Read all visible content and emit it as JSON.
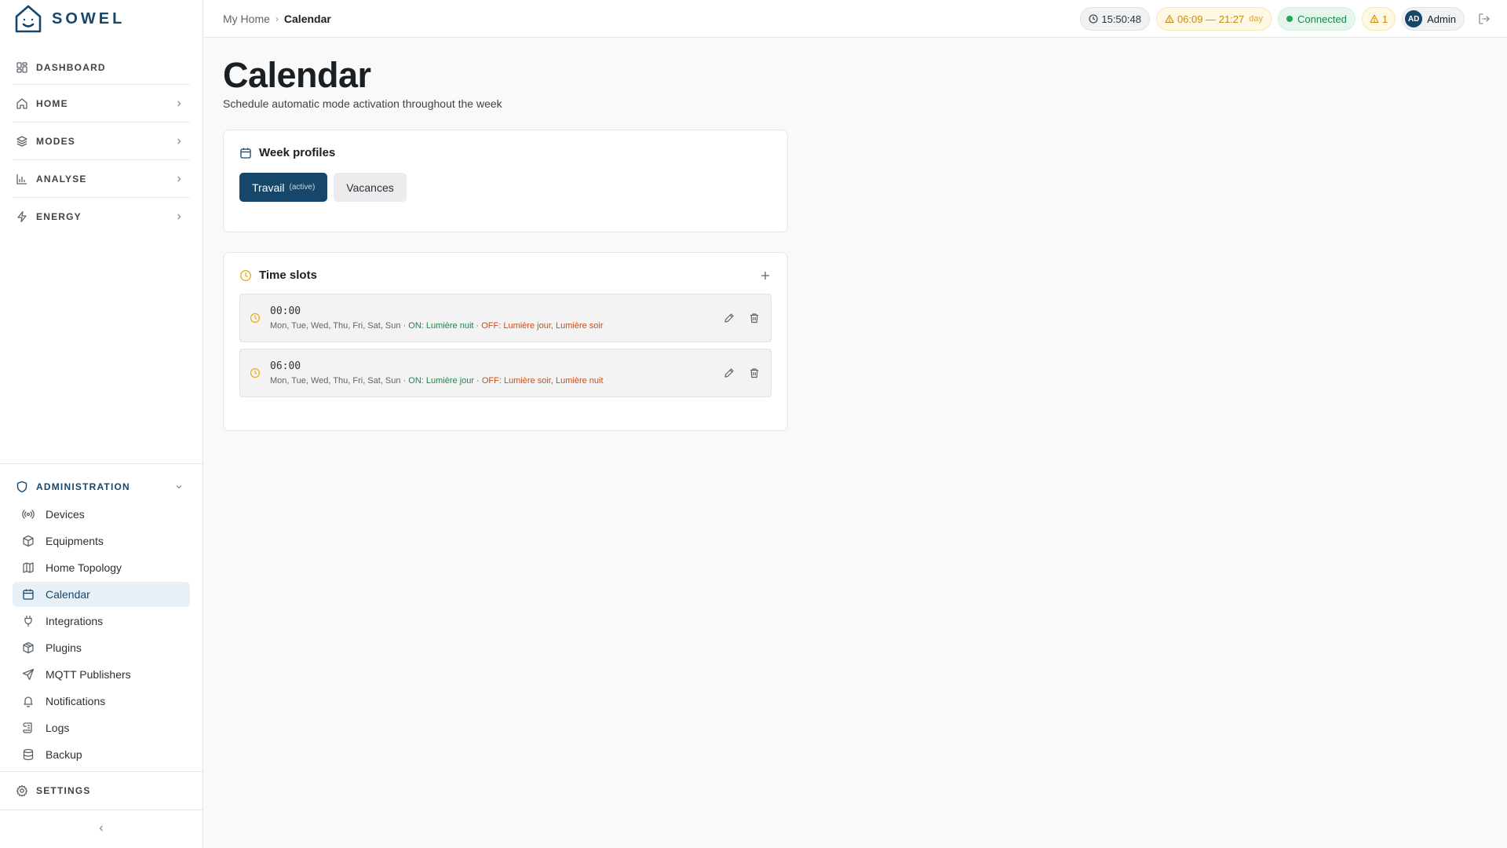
{
  "app": {
    "name": "SOWEL"
  },
  "nav": {
    "items": [
      {
        "label": "DASHBOARD",
        "icon": "dashboard-icon"
      },
      {
        "label": "HOME",
        "icon": "home-icon"
      },
      {
        "label": "MODES",
        "icon": "layers-icon"
      },
      {
        "label": "ANALYSE",
        "icon": "bar-chart-icon"
      },
      {
        "label": "ENERGY",
        "icon": "zap-icon"
      }
    ],
    "admin": {
      "label": "ADMINISTRATION",
      "items": [
        {
          "label": "Devices",
          "icon": "radio-icon"
        },
        {
          "label": "Equipments",
          "icon": "box-icon"
        },
        {
          "label": "Home Topology",
          "icon": "map-icon"
        },
        {
          "label": "Calendar",
          "icon": "calendar-icon"
        },
        {
          "label": "Integrations",
          "icon": "plug-icon"
        },
        {
          "label": "Plugins",
          "icon": "package-icon"
        },
        {
          "label": "MQTT Publishers",
          "icon": "send-icon"
        },
        {
          "label": "Notifications",
          "icon": "bell-icon"
        },
        {
          "label": "Logs",
          "icon": "scroll-icon"
        },
        {
          "label": "Backup",
          "icon": "database-icon"
        }
      ]
    },
    "settings_label": "SETTINGS"
  },
  "topbar": {
    "breadcrumb": [
      "My Home",
      "Calendar"
    ],
    "clock": "15:50:48",
    "sun": "06:09 — 21:27",
    "sun_period": "day",
    "connection": "Connected",
    "alerts": "1",
    "user_initials": "AD",
    "user_name": "Admin"
  },
  "page": {
    "title": "Calendar",
    "subtitle": "Schedule automatic mode activation throughout the week"
  },
  "week_profiles": {
    "title": "Week profiles",
    "profiles": [
      {
        "label": "Travail",
        "tag": "(active)"
      },
      {
        "label": "Vacances"
      }
    ]
  },
  "time_slots": {
    "title": "Time slots",
    "slots": [
      {
        "time": "00:00",
        "days": "Mon, Tue, Wed, Thu, Fri, Sat, Sun",
        "sep": " · ",
        "on": "ON: Lumière nuit",
        "off": "OFF: Lumière jour, Lumière soir"
      },
      {
        "time": "06:00",
        "days": "Mon, Tue, Wed, Thu, Fri, Sat, Sun",
        "sep": " · ",
        "on": "ON: Lumière jour",
        "off": "OFF: Lumière soir, Lumière nuit"
      }
    ]
  },
  "colors": {
    "brand": "#17466b",
    "on": "#17874a",
    "off": "#c4501f",
    "warn": "#c98b07"
  }
}
